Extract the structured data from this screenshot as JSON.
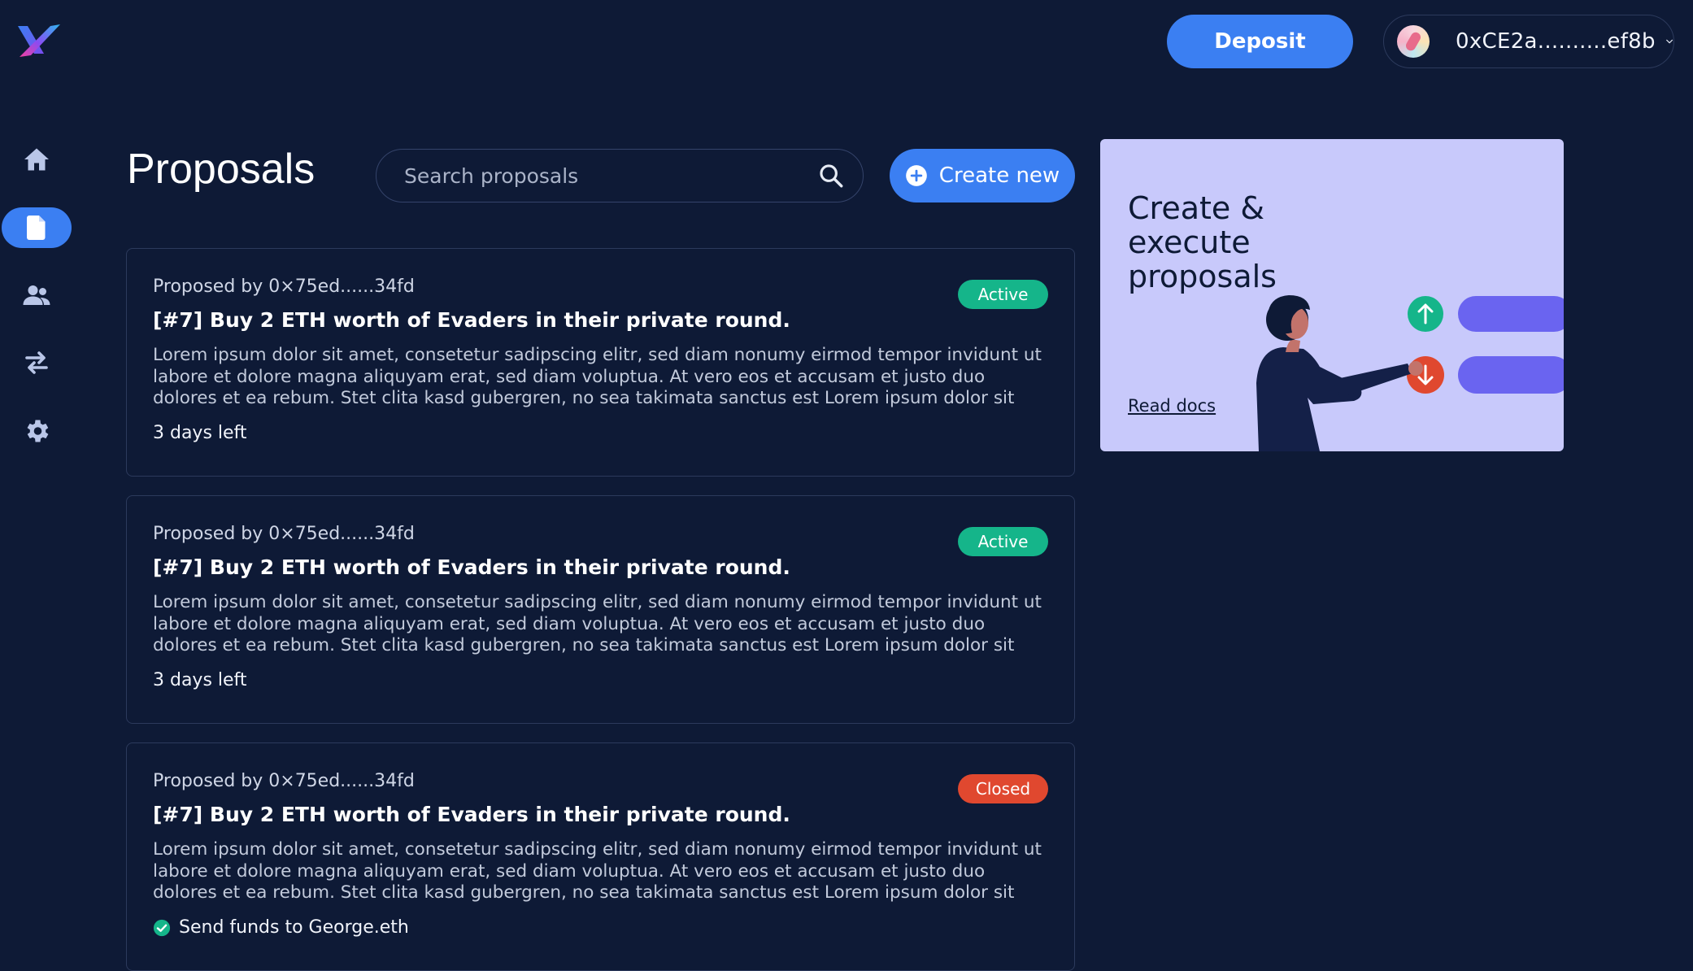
{
  "header": {
    "deposit_label": "Deposit",
    "wallet_address": "0xCE2a..........ef8b"
  },
  "sidebar": {
    "items": [
      {
        "name": "home",
        "icon": "home-icon",
        "active": false
      },
      {
        "name": "proposals",
        "icon": "document-icon",
        "active": true
      },
      {
        "name": "members",
        "icon": "users-icon",
        "active": false
      },
      {
        "name": "transfers",
        "icon": "swap-icon",
        "active": false
      },
      {
        "name": "settings",
        "icon": "gear-icon",
        "active": false
      }
    ]
  },
  "main": {
    "title": "Proposals",
    "search": {
      "placeholder": "Search proposals"
    },
    "create_label": "Create new",
    "proposals": [
      {
        "proposed_by": "Proposed by 0×75ed......34fd",
        "status": "Active",
        "title": "[#7] Buy 2 ETH worth of Evaders in their private round.",
        "description": "Lorem ipsum dolor sit amet, consetetur sadipscing elitr, sed diam nonumy eirmod tempor invidunt ut labore et dolore magna aliquyam erat, sed diam voluptua. At vero eos et accusam et justo duo dolores et ea rebum. Stet clita kasd gubergren, no sea takimata sanctus est Lorem ipsum dolor sit amet. Lorem",
        "footer": "3 days left"
      },
      {
        "proposed_by": "Proposed by 0×75ed......34fd",
        "status": "Active",
        "title": "[#7] Buy 2 ETH worth of Evaders in their private round.",
        "description": "Lorem ipsum dolor sit amet, consetetur sadipscing elitr, sed diam nonumy eirmod tempor invidunt ut labore et dolore magna aliquyam erat, sed diam voluptua. At vero eos et accusam et justo duo dolores et ea rebum. Stet clita kasd gubergren, no sea takimata sanctus est Lorem ipsum dolor sit amet. Lorem",
        "footer": "3 days left"
      },
      {
        "proposed_by": "Proposed by 0×75ed......34fd",
        "status": "Closed",
        "title": "[#7] Buy 2 ETH worth of Evaders in their private round.",
        "description": "Lorem ipsum dolor sit amet, consetetur sadipscing elitr, sed diam nonumy eirmod tempor invidunt ut labore et dolore magna aliquyam erat, sed diam voluptua. At vero eos et accusam et justo duo dolores et ea rebum. Stet clita kasd gubergren, no sea takimata sanctus est Lorem ipsum dolor sit amet. Lorem",
        "footer": "Send funds to George.eth"
      }
    ]
  },
  "promo": {
    "title": "Create & execute proposals",
    "link_label": "Read docs"
  },
  "colors": {
    "background": "#0e1a36",
    "accent": "#3b7ff2",
    "active": "#15b58a",
    "closed": "#e0482f",
    "promo_bg": "#c8c9fb",
    "promo_bar": "#6a64f0"
  }
}
